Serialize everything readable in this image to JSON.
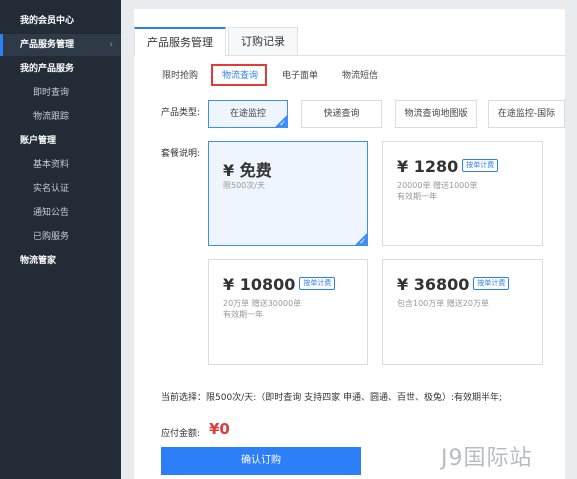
{
  "sidebar": {
    "items": [
      {
        "label": "我的会员中心",
        "type": "group"
      },
      {
        "label": "产品服务管理",
        "type": "active",
        "chevron": "›"
      },
      {
        "label": "我的产品服务",
        "type": "group"
      },
      {
        "label": "即时查询",
        "type": "sub"
      },
      {
        "label": "物流跟踪",
        "type": "sub"
      },
      {
        "label": "账户管理",
        "type": "group"
      },
      {
        "label": "基本资料",
        "type": "sub"
      },
      {
        "label": "实名认证",
        "type": "sub"
      },
      {
        "label": "通知公告",
        "type": "sub"
      },
      {
        "label": "已购服务",
        "type": "sub"
      },
      {
        "label": "物流管家",
        "type": "group"
      }
    ]
  },
  "tabs": {
    "product": "产品服务管理",
    "orders": "订购记录"
  },
  "subtabs": [
    "限时抢购",
    "物流查询",
    "电子面单",
    "物流短信"
  ],
  "product_type": {
    "label": "产品类型:",
    "options": [
      "在途监控",
      "快递查询",
      "物流查询地图版",
      "在途监控-国际"
    ],
    "selected": "在途监控"
  },
  "package": {
    "label": "套餐说明:",
    "cards": [
      {
        "price": "¥ 免费",
        "badge": "",
        "line1": "限500次/天",
        "line2": "",
        "selected": true
      },
      {
        "price": "¥ 1280",
        "badge": "按单计费",
        "line1": "20000单  赠送1000单",
        "line2": "有效期一年",
        "selected": false
      },
      {
        "price": "¥ 10800",
        "badge": "按单计费",
        "line1": "20万单  赠送30000单",
        "line2": "有效期一年",
        "selected": false
      },
      {
        "price": "¥ 36800",
        "badge": "按单计费",
        "line1": "包含100万单  赠送20万单",
        "line2": "",
        "selected": false
      }
    ]
  },
  "current_selection": "当前选择：限500次/天:（即时查询 支持四家 申通、圆通、百世、极兔）:有效期半年;",
  "amount": {
    "label": "应付金额:",
    "value": "¥0"
  },
  "confirm_button": "确认订购",
  "watermark": "J9国际站",
  "colors": {
    "accent": "#2d7ff9",
    "price_red": "#e23b3b",
    "sidebar_bg": "#232b36"
  }
}
